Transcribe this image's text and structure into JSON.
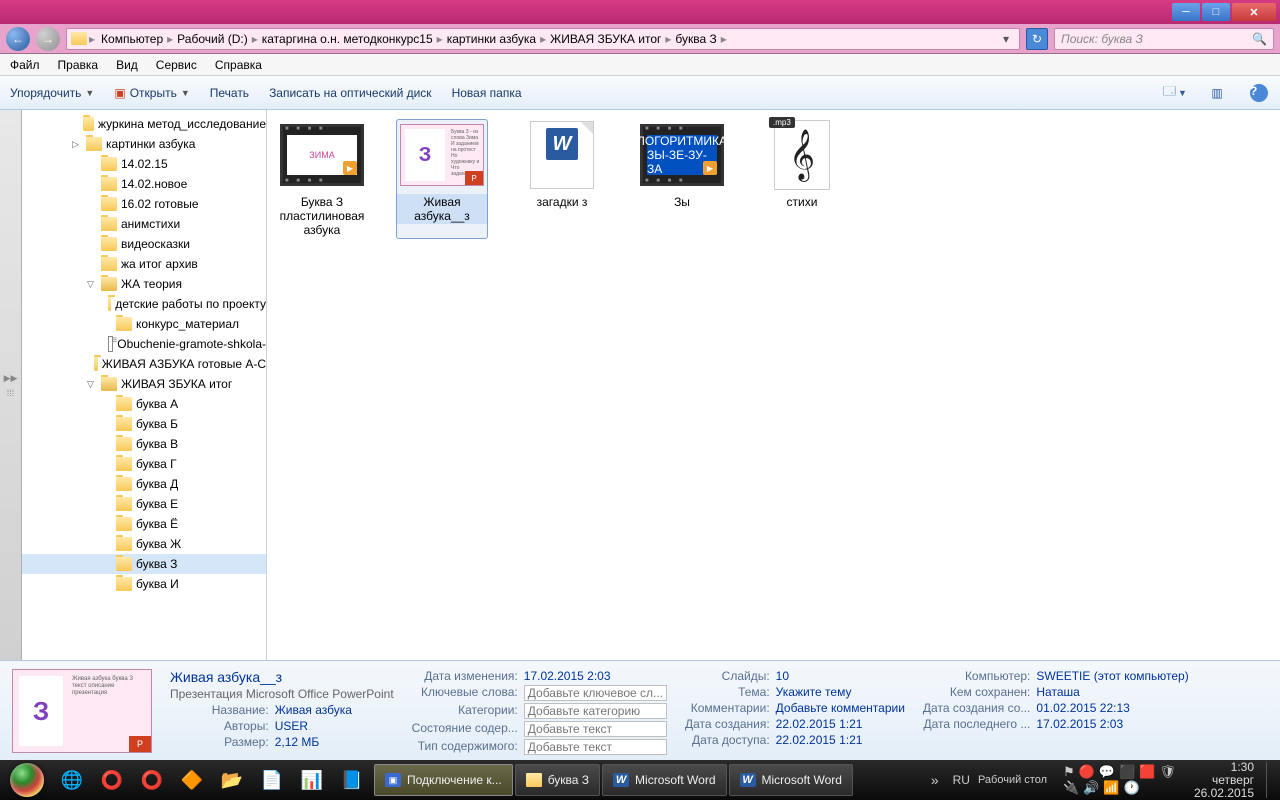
{
  "window_controls": {
    "min": "─",
    "max": "□",
    "close": "✕"
  },
  "nav": {
    "back": "←",
    "forward": "→",
    "refresh": "↻"
  },
  "breadcrumb": [
    "Компьютер",
    "Рабочий (D:)",
    "катаргина о.н. методконкурс15",
    "картинки азбука",
    "ЖИВАЯ ЗБУКА итог",
    "буква З"
  ],
  "search_placeholder": "Поиск: буква З",
  "menu": [
    "Файл",
    "Правка",
    "Вид",
    "Сервис",
    "Справка"
  ],
  "toolbar": {
    "organize": "Упорядочить",
    "open": "Открыть",
    "print": "Печать",
    "burn": "Записать на оптический диск",
    "new_folder": "Новая папка"
  },
  "tree": [
    {
      "indent": 50,
      "icon": "folder",
      "label": "журкина метод_исследование"
    },
    {
      "indent": 50,
      "icon": "folder",
      "label": "картинки азбука",
      "expand": "▷"
    },
    {
      "indent": 65,
      "icon": "folder",
      "label": "14.02.15"
    },
    {
      "indent": 65,
      "icon": "folder",
      "label": "14.02.новое"
    },
    {
      "indent": 65,
      "icon": "folder",
      "label": "16.02 готовые"
    },
    {
      "indent": 65,
      "icon": "folder",
      "label": "анимстихи"
    },
    {
      "indent": 65,
      "icon": "folder",
      "label": "видеосказки"
    },
    {
      "indent": 65,
      "icon": "folder",
      "label": "жа итог архив"
    },
    {
      "indent": 65,
      "icon": "folder-open",
      "label": "ЖА теория",
      "expand": "▽"
    },
    {
      "indent": 80,
      "icon": "folder",
      "label": "детские работы по проекту"
    },
    {
      "indent": 80,
      "icon": "folder",
      "label": "конкурс_материал"
    },
    {
      "indent": 80,
      "icon": "doc",
      "label": "Obuchenie-gramote-shkola-"
    },
    {
      "indent": 65,
      "icon": "folder",
      "label": "ЖИВАЯ АЗБУКА готовые А-С"
    },
    {
      "indent": 65,
      "icon": "folder-open",
      "label": "ЖИВАЯ ЗБУКА итог",
      "expand": "▽"
    },
    {
      "indent": 80,
      "icon": "folder",
      "label": "буква А"
    },
    {
      "indent": 80,
      "icon": "folder",
      "label": "буква Б"
    },
    {
      "indent": 80,
      "icon": "folder",
      "label": "буква В"
    },
    {
      "indent": 80,
      "icon": "folder",
      "label": "буква Г"
    },
    {
      "indent": 80,
      "icon": "folder",
      "label": "буква Д"
    },
    {
      "indent": 80,
      "icon": "folder",
      "label": "буква Е"
    },
    {
      "indent": 80,
      "icon": "folder",
      "label": "буква Ё"
    },
    {
      "indent": 80,
      "icon": "folder",
      "label": "буква Ж"
    },
    {
      "indent": 80,
      "icon": "folder",
      "label": "буква З",
      "selected": true
    },
    {
      "indent": 80,
      "icon": "folder",
      "label": "буква И"
    }
  ],
  "files": [
    {
      "type": "video",
      "label": "Буква З пластилиновая азбука",
      "inner": "ЗИМА"
    },
    {
      "type": "ppt",
      "label": "Живая азбука__з",
      "selected": true,
      "letter": "З"
    },
    {
      "type": "word",
      "label": "загадки з"
    },
    {
      "type": "video-logo",
      "label": "Зы",
      "inner1": "ЛОГОРИТМИКА",
      "inner2": "ЗЫ-ЗЕ-ЗУ-ЗА"
    },
    {
      "type": "mp3",
      "label": "стихи",
      "tag": ".mp3"
    }
  ],
  "details": {
    "title": "Живая азбука__з",
    "subtitle": "Презентация Microsoft Office PowerPoint",
    "cols": [
      [
        {
          "label": "Название:",
          "value": "Живая азбука"
        },
        {
          "label": "Авторы:",
          "value": "USER"
        },
        {
          "label": "Размер:",
          "value": "2,12 МБ"
        }
      ],
      [
        {
          "label": "Дата изменения:",
          "value": "17.02.2015 2:03"
        },
        {
          "label": "Ключевые слова:",
          "value": "Добавьте ключевое сл...",
          "edit": true
        },
        {
          "label": "Категории:",
          "value": "Добавьте категорию",
          "edit": true
        },
        {
          "label": "Состояние содер...",
          "value": "Добавьте текст",
          "edit": true
        },
        {
          "label": "Тип содержимого:",
          "value": "Добавьте текст",
          "edit": true
        }
      ],
      [
        {
          "label": "Слайды:",
          "value": "10"
        },
        {
          "label": "Тема:",
          "value": "Укажите тему"
        },
        {
          "label": "Комментарии:",
          "value": "Добавьте комментарии"
        },
        {
          "label": "Дата создания:",
          "value": "22.02.2015 1:21"
        },
        {
          "label": "Дата доступа:",
          "value": "22.02.2015 1:21"
        }
      ],
      [
        {
          "label": "Компьютер:",
          "value": "SWEETIE (этот компьютер)"
        },
        {
          "label": "Кем сохранен:",
          "value": "Наташа"
        },
        {
          "label": "Дата создания со...",
          "value": "01.02.2015 22:13"
        },
        {
          "label": "Дата последнего ...",
          "value": "17.02.2015 2:03"
        }
      ]
    ]
  },
  "taskbar": {
    "pinned_chars": [
      "🌐",
      "⭕",
      "⭕",
      "🔶",
      "📂",
      "📄",
      "📊",
      "📘"
    ],
    "tasks": [
      {
        "label": "Подключение к...",
        "icon": "mon",
        "active": true
      },
      {
        "label": "буква З",
        "icon": "folder"
      },
      {
        "label": "Microsoft Word",
        "icon": "word"
      },
      {
        "label": "Microsoft Word",
        "icon": "word"
      }
    ],
    "desktop_label": "Рабочий стол",
    "overflow": "»",
    "lang": "RU",
    "tray_icons": [
      "⚑",
      "🔴",
      "💬",
      "⬛",
      "🟥",
      "🛡"
    ],
    "tray_icons2": [
      "🔌",
      "🔊",
      "📶",
      "🕐"
    ],
    "clock": {
      "time": "1:30",
      "day": "четверг",
      "date": "26.02.2015"
    }
  }
}
